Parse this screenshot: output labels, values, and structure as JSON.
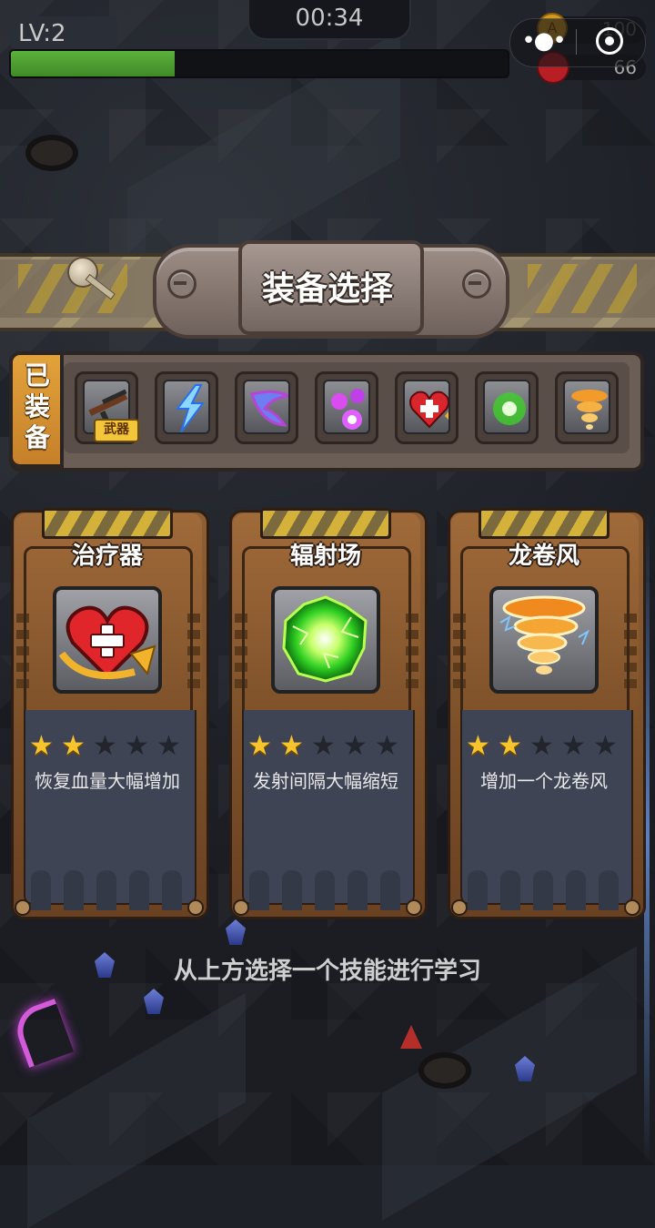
{
  "hud": {
    "level": "LV:2",
    "xp_fraction": 0.33,
    "timer": "00:34",
    "coins": "100",
    "kills": "66",
    "more_glyph": "•●•"
  },
  "panel_title": "装备选择",
  "equipped": {
    "label": "已装备",
    "weapon_tag": "武器",
    "slots": [
      {
        "icon": "assault-rifle-icon"
      },
      {
        "icon": "lightning-icon"
      },
      {
        "icon": "boomerang-icon"
      },
      {
        "icon": "energy-orbs-icon"
      },
      {
        "icon": "heal-heart-icon"
      },
      {
        "icon": "radiation-field-icon"
      },
      {
        "icon": "tornado-icon"
      }
    ]
  },
  "cards": [
    {
      "title": "治疗器",
      "icon": "heal-heart-icon",
      "stars_filled": 2,
      "stars_total": 5,
      "desc": "恢复血量大幅增加"
    },
    {
      "title": "辐射场",
      "icon": "radiation-field-icon",
      "stars_filled": 2,
      "stars_total": 5,
      "desc": "发射间隔大幅缩短"
    },
    {
      "title": "龙卷风",
      "icon": "tornado-icon",
      "stars_filled": 2,
      "stars_total": 5,
      "desc": "增加一个龙卷风"
    }
  ],
  "hint": "从上方选择一个技能进行学习",
  "colors": {
    "xp_green": "#4f9e32",
    "star_gold": "#f6c42b",
    "tag_orange": "#d8912f",
    "card_brown": "#8f5f33"
  }
}
